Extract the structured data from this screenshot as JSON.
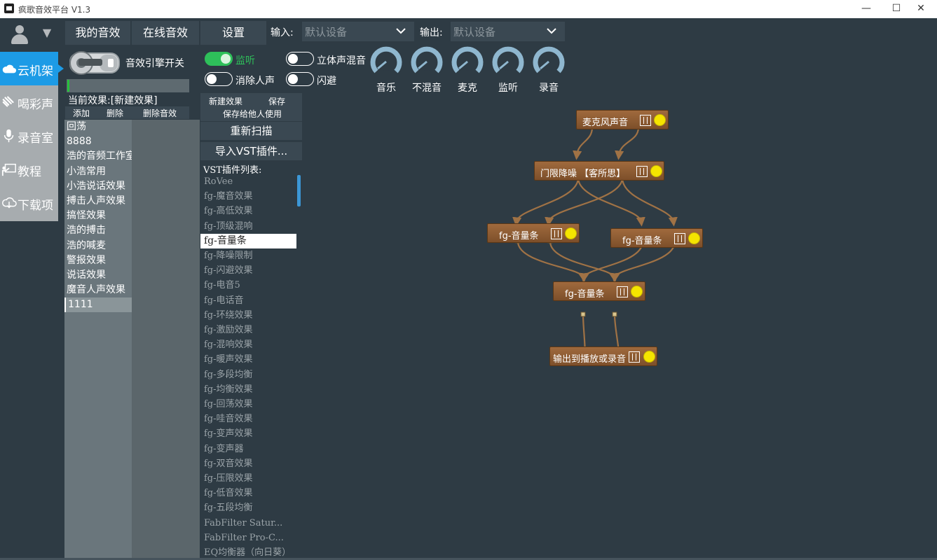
{
  "window": {
    "title": "疯歌音效平台 V1.3",
    "controls": [
      "—",
      "☐",
      "✕"
    ]
  },
  "user": {
    "dropdown_glyph": "▼"
  },
  "nav": [
    {
      "label": "云机架",
      "icon": "cloud-icon",
      "active": true
    },
    {
      "label": "喝彩声",
      "icon": "clap-icon",
      "active": false
    },
    {
      "label": "录音室",
      "icon": "microphone-icon",
      "active": false
    },
    {
      "label": "教程",
      "icon": "board-icon",
      "active": false
    },
    {
      "label": "下载项",
      "icon": "cloud-download-icon",
      "active": false
    }
  ],
  "tabs": [
    "我的音效",
    "在线音效",
    "设置"
  ],
  "io": {
    "input_label": "输入:",
    "input_value": "默认设备",
    "output_label": "输出:",
    "output_value": "默认设备"
  },
  "engine": {
    "label": "音效引擎开关",
    "level_fraction": 0.02
  },
  "toggles": [
    {
      "label": "监听",
      "on": true
    },
    {
      "label": "消除人声",
      "on": false
    },
    {
      "label": "立体声混音",
      "on": false
    },
    {
      "label": "闪避",
      "on": false
    }
  ],
  "knobs": [
    "音乐",
    "不混音",
    "麦克",
    "监听",
    "录音"
  ],
  "current_effect": {
    "label": "当前效果:[新建效果]",
    "buttons": [
      "添加",
      "删除",
      "删除音效"
    ]
  },
  "effects": [
    "回荡",
    "8888",
    "浩的音频工作室",
    "小浩常用",
    "小浩说话效果",
    "搏击人声效果",
    "搞怪效果",
    "浩的搏击",
    "浩的喊麦",
    "警报效果",
    "说话效果",
    "魔音人声效果",
    "1111"
  ],
  "selected_effect_index": 12,
  "mid_buttons": {
    "new_effect": "新建效果",
    "save": "保存",
    "save_share": "保存给他人使用",
    "rescan": "重新扫描",
    "import_vst": "导入VST插件..."
  },
  "vst": {
    "title": "VST插件列表:",
    "items": [
      "RoVee",
      "fg-魔音效果",
      "fg-高低效果",
      "fg-顶级混响",
      "fg-音量条",
      "fg-降噪限制",
      "fg-闪避效果",
      "fg-电音5",
      "fg-电话音",
      "fg-环绕效果",
      "fg-激励效果",
      "fg-混响效果",
      "fg-暖声效果",
      "fg-多段均衡",
      "fg-均衡效果",
      "fg-回荡效果",
      "fg-哇音效果",
      "fg-变声效果",
      "fg-变声器",
      "fg-双音效果",
      "fg-压限效果",
      "fg-低音效果",
      "fg-五段均衡",
      "FabFilter Satur...",
      "FabFilter Pro-C...",
      "EQ均衡器（向日葵）"
    ],
    "selected_index": 4
  },
  "graph": {
    "nodes": [
      "麦克风声音",
      "门限降噪    【客所思】",
      "fg-音量条",
      "fg-音量条",
      "fg-音量条",
      "输出到播放或录音"
    ],
    "wire_color": "#a07245",
    "node_color": "#8a5a33",
    "indicator_color": "#f5e400"
  },
  "colors": {
    "background": "#2e3b44",
    "accent": "#1d9be6",
    "toggle_on": "#2ec05a"
  }
}
